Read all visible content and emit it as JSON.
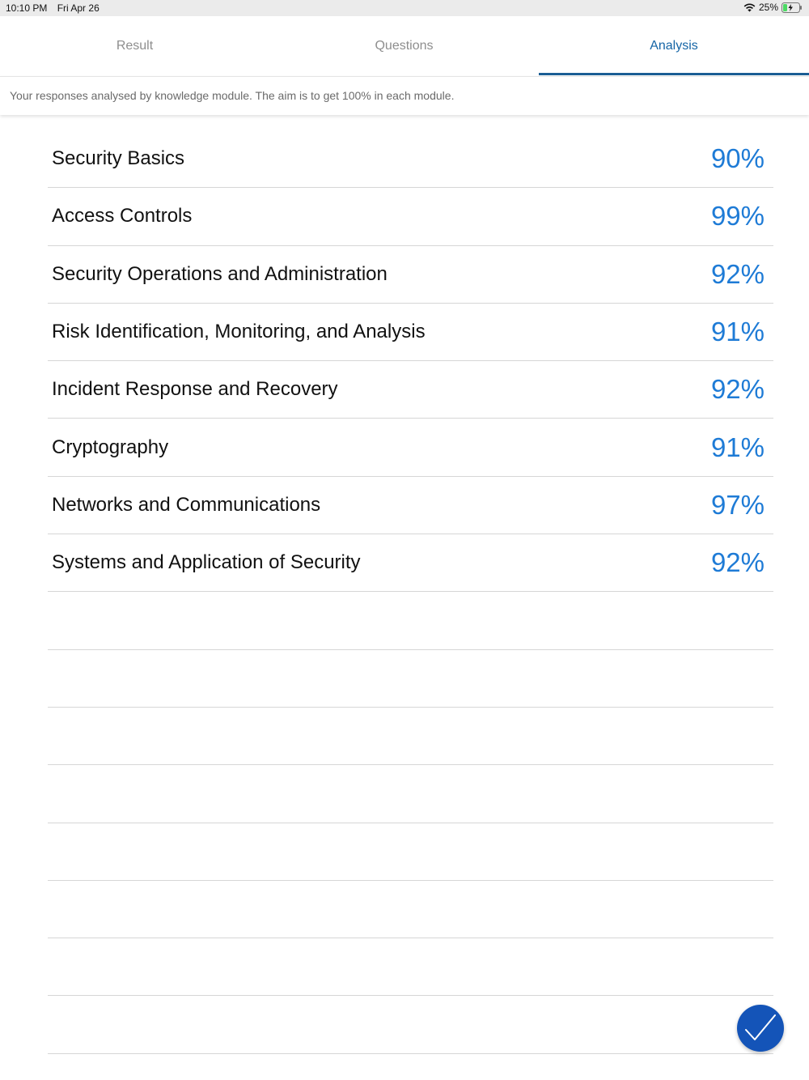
{
  "status_bar": {
    "time": "10:10 PM",
    "date": "Fri Apr 26",
    "battery": "25%",
    "battery_color": "#4cd964"
  },
  "tabs": [
    {
      "label": "Result"
    },
    {
      "label": "Questions"
    },
    {
      "label": "Analysis",
      "active": true
    }
  ],
  "accent_color": "#1565a6",
  "subheader": "Your responses analysed by knowledge module. The aim is to get 100% in each module.",
  "modules": [
    {
      "name": "Security Basics",
      "score": "90%"
    },
    {
      "name": "Access Controls",
      "score": "99%"
    },
    {
      "name": "Security Operations and Administration",
      "score": "92%"
    },
    {
      "name": "Risk Identification, Monitoring, and Analysis",
      "score": "91%"
    },
    {
      "name": "Incident Response and Recovery",
      "score": "92%"
    },
    {
      "name": "Cryptography",
      "score": "91%"
    },
    {
      "name": "Networks and Communications",
      "score": "97%"
    },
    {
      "name": "Systems and Application of Security",
      "score": "92%"
    }
  ],
  "empty_rows": 8,
  "fab": {
    "icon": "checkmark-icon"
  }
}
